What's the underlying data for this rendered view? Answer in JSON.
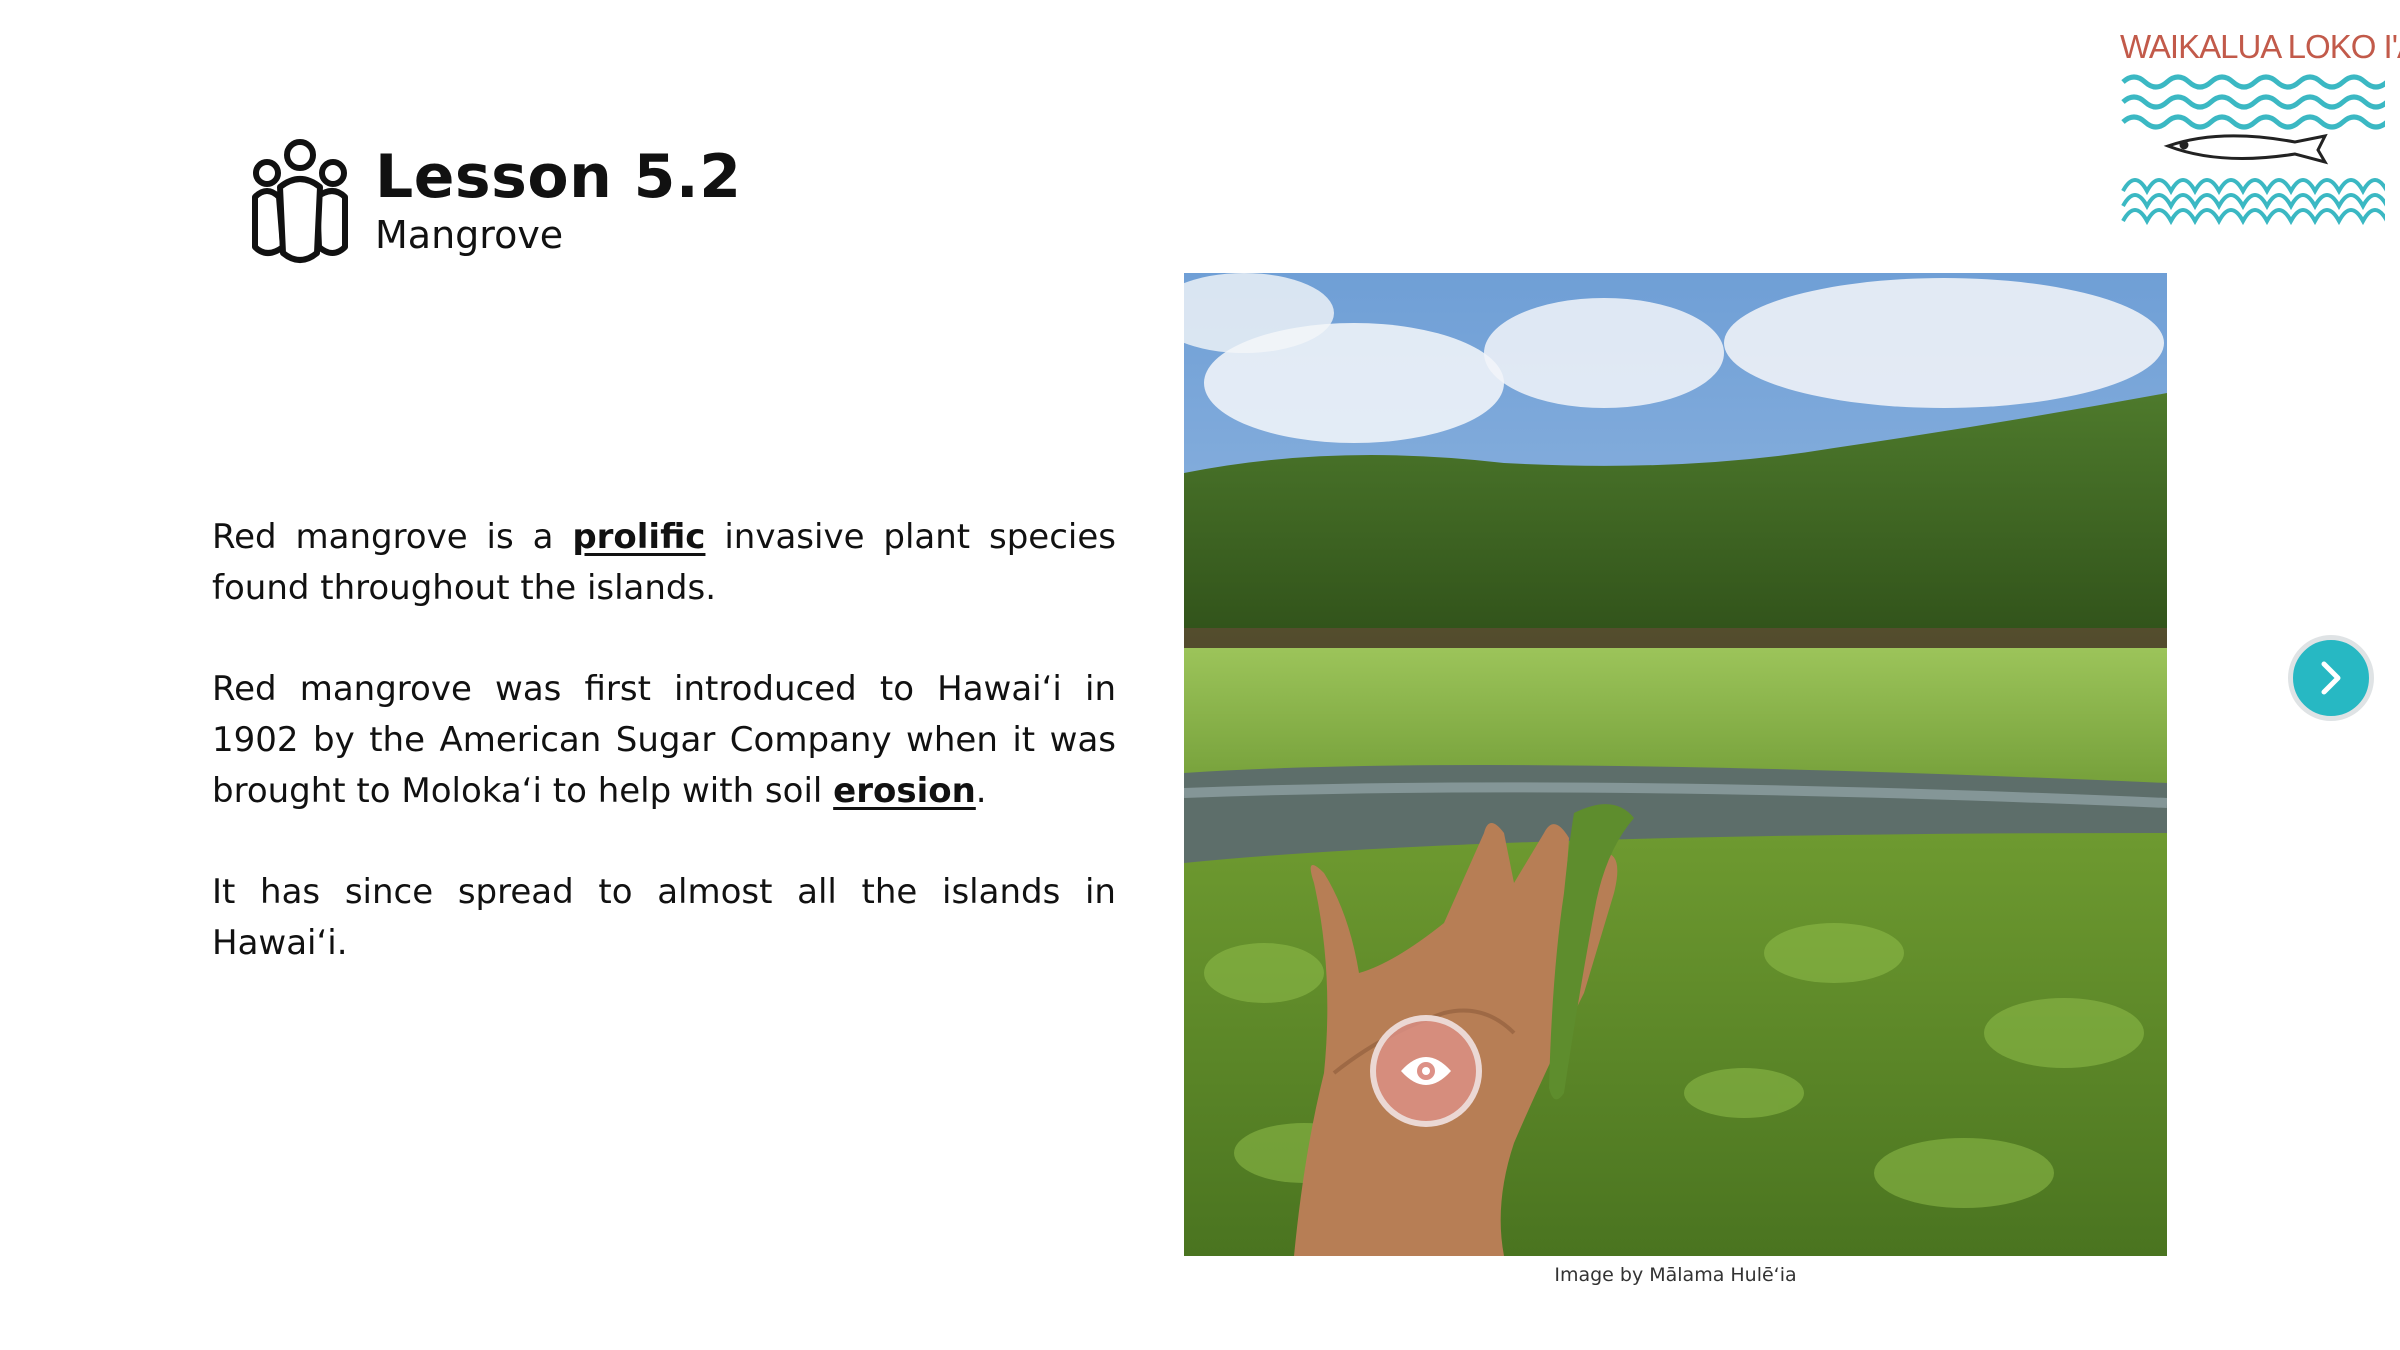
{
  "lesson": {
    "title": "Lesson 5.2",
    "subtitle": "Mangrove"
  },
  "logo": {
    "text": "WAIKALUA LOKO I'A",
    "color": "#c25a4a",
    "wave_color": "#3bb8c3"
  },
  "body": {
    "p1": {
      "a": "Red mangrove is a ",
      "kw": "prolific",
      "b": " invasive plant species found throughout the islands."
    },
    "p2": {
      "a": "Red mangrove was first introduced to Hawaiʻi in 1902 by the American Sugar Company when it was brought to Molokaʻi to help with soil ",
      "kw": "erosion",
      "b": "."
    },
    "p3": "It has since spread to almost all the islands in Hawaiʻi."
  },
  "image": {
    "caption": "Image by Mālama Hulēʻia"
  },
  "controls": {
    "eye_icon": "eye-icon",
    "next_icon": "chevron-right-icon",
    "accent": "#27b8c3"
  }
}
